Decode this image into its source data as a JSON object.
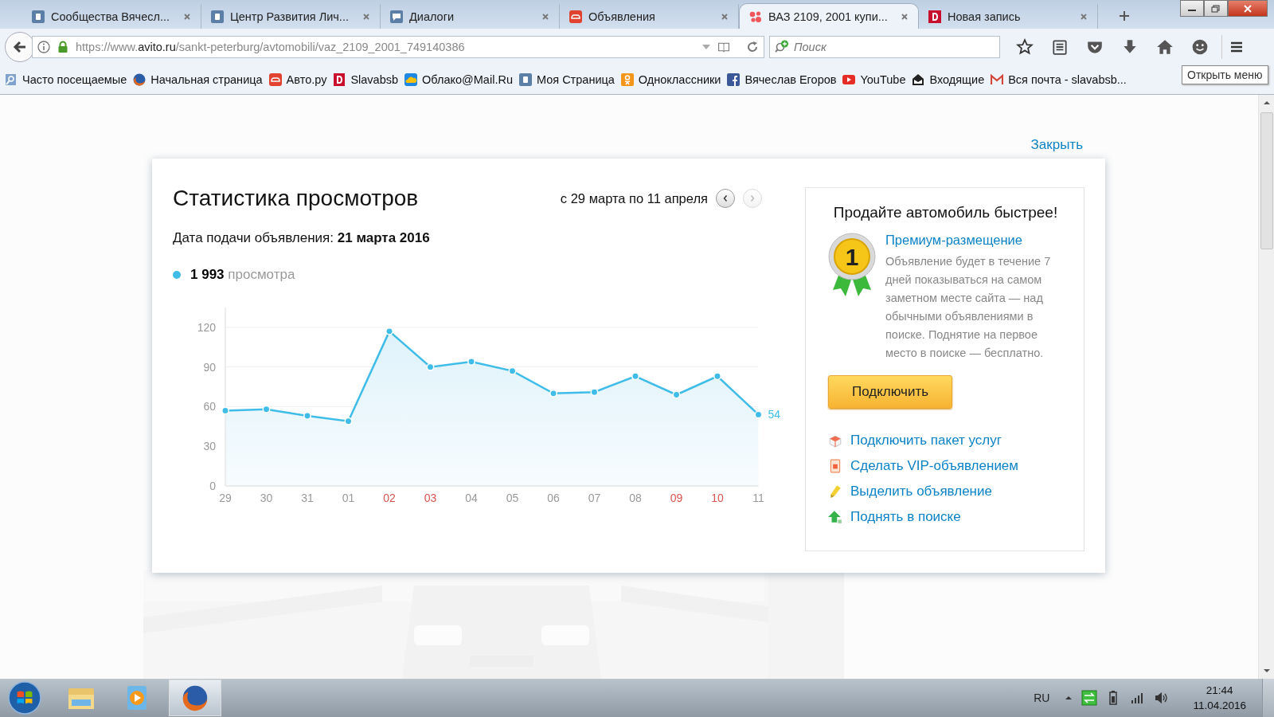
{
  "tabs": [
    {
      "title": "Сообщества Вячесл...",
      "selected": false
    },
    {
      "title": "Центр Развития Лич...",
      "selected": false
    },
    {
      "title": "Диалоги",
      "selected": false
    },
    {
      "title": "Объявления",
      "selected": false
    },
    {
      "title": "ВАЗ 2109, 2001 купи...",
      "selected": true
    },
    {
      "title": "Новая запись",
      "selected": false
    }
  ],
  "address_bar": {
    "prefix": "https://www.",
    "domain": "avito.ru",
    "path": "/sankt-peterburg/avtomobili/vaz_2109_2001_749140386"
  },
  "search": {
    "placeholder": "Поиск"
  },
  "bookmarks": [
    "Часто посещаемые",
    "Начальная страница",
    "Авто.ру",
    "Slavabsb",
    "Облако@Mail.Ru",
    "Моя Страница",
    "Одноклассники",
    "Вячеслав Егоров",
    "YouTube",
    "Входящие",
    "Вся почта - slavabsb..."
  ],
  "tooltip": "Открыть меню",
  "close_link": "Закрыть",
  "stats": {
    "title": "Статистика просмотров",
    "period": "с 29 марта по 11 апреля",
    "prev_enabled": true,
    "next_enabled": false,
    "posted_label": "Дата подачи объявления:",
    "posted_date": "21 марта 2016",
    "total_count": "1 993",
    "weekend": [
      false,
      false,
      false,
      false,
      true,
      true,
      false,
      false,
      false,
      false,
      false,
      true,
      true,
      false
    ],
    "chart_data": {
      "type": "area",
      "categories": [
        "29",
        "30",
        "31",
        "01",
        "02",
        "03",
        "04",
        "05",
        "06",
        "07",
        "08",
        "09",
        "10",
        "11"
      ],
      "series": [
        {
          "name": "просмотра",
          "color": "#3fbde8",
          "values": [
            57,
            58,
            53,
            49,
            117,
            90,
            94,
            87,
            70,
            71,
            83,
            69,
            83,
            54
          ]
        }
      ],
      "ylim": [
        0,
        135
      ],
      "yticks": [
        0,
        30,
        60,
        90,
        120
      ],
      "grid": true,
      "annotations": [
        {
          "x": "11",
          "y": 54,
          "text": "54"
        }
      ]
    }
  },
  "promo": {
    "title": "Продайте автомобиль быстрее!",
    "medal_number": "1",
    "premium_link": "Премиум-размещение",
    "description": "Объявление будет в течение 7 дней показываться на самом заметном месте сайта — над обычными объявлениями в поиске. Поднятие на первое место в поиске — бесплатно.",
    "button": "Подключить",
    "links": [
      {
        "label": "Подключить пакет услуг",
        "kind": "package"
      },
      {
        "label": "Сделать VIP-объявлением",
        "kind": "vip"
      },
      {
        "label": "Выделить объявление",
        "kind": "highlight"
      },
      {
        "label": "Поднять в поиске",
        "kind": "raise"
      }
    ]
  },
  "taskbar": {
    "language": "RU",
    "time": "21:44",
    "date": "11.04.2016"
  }
}
